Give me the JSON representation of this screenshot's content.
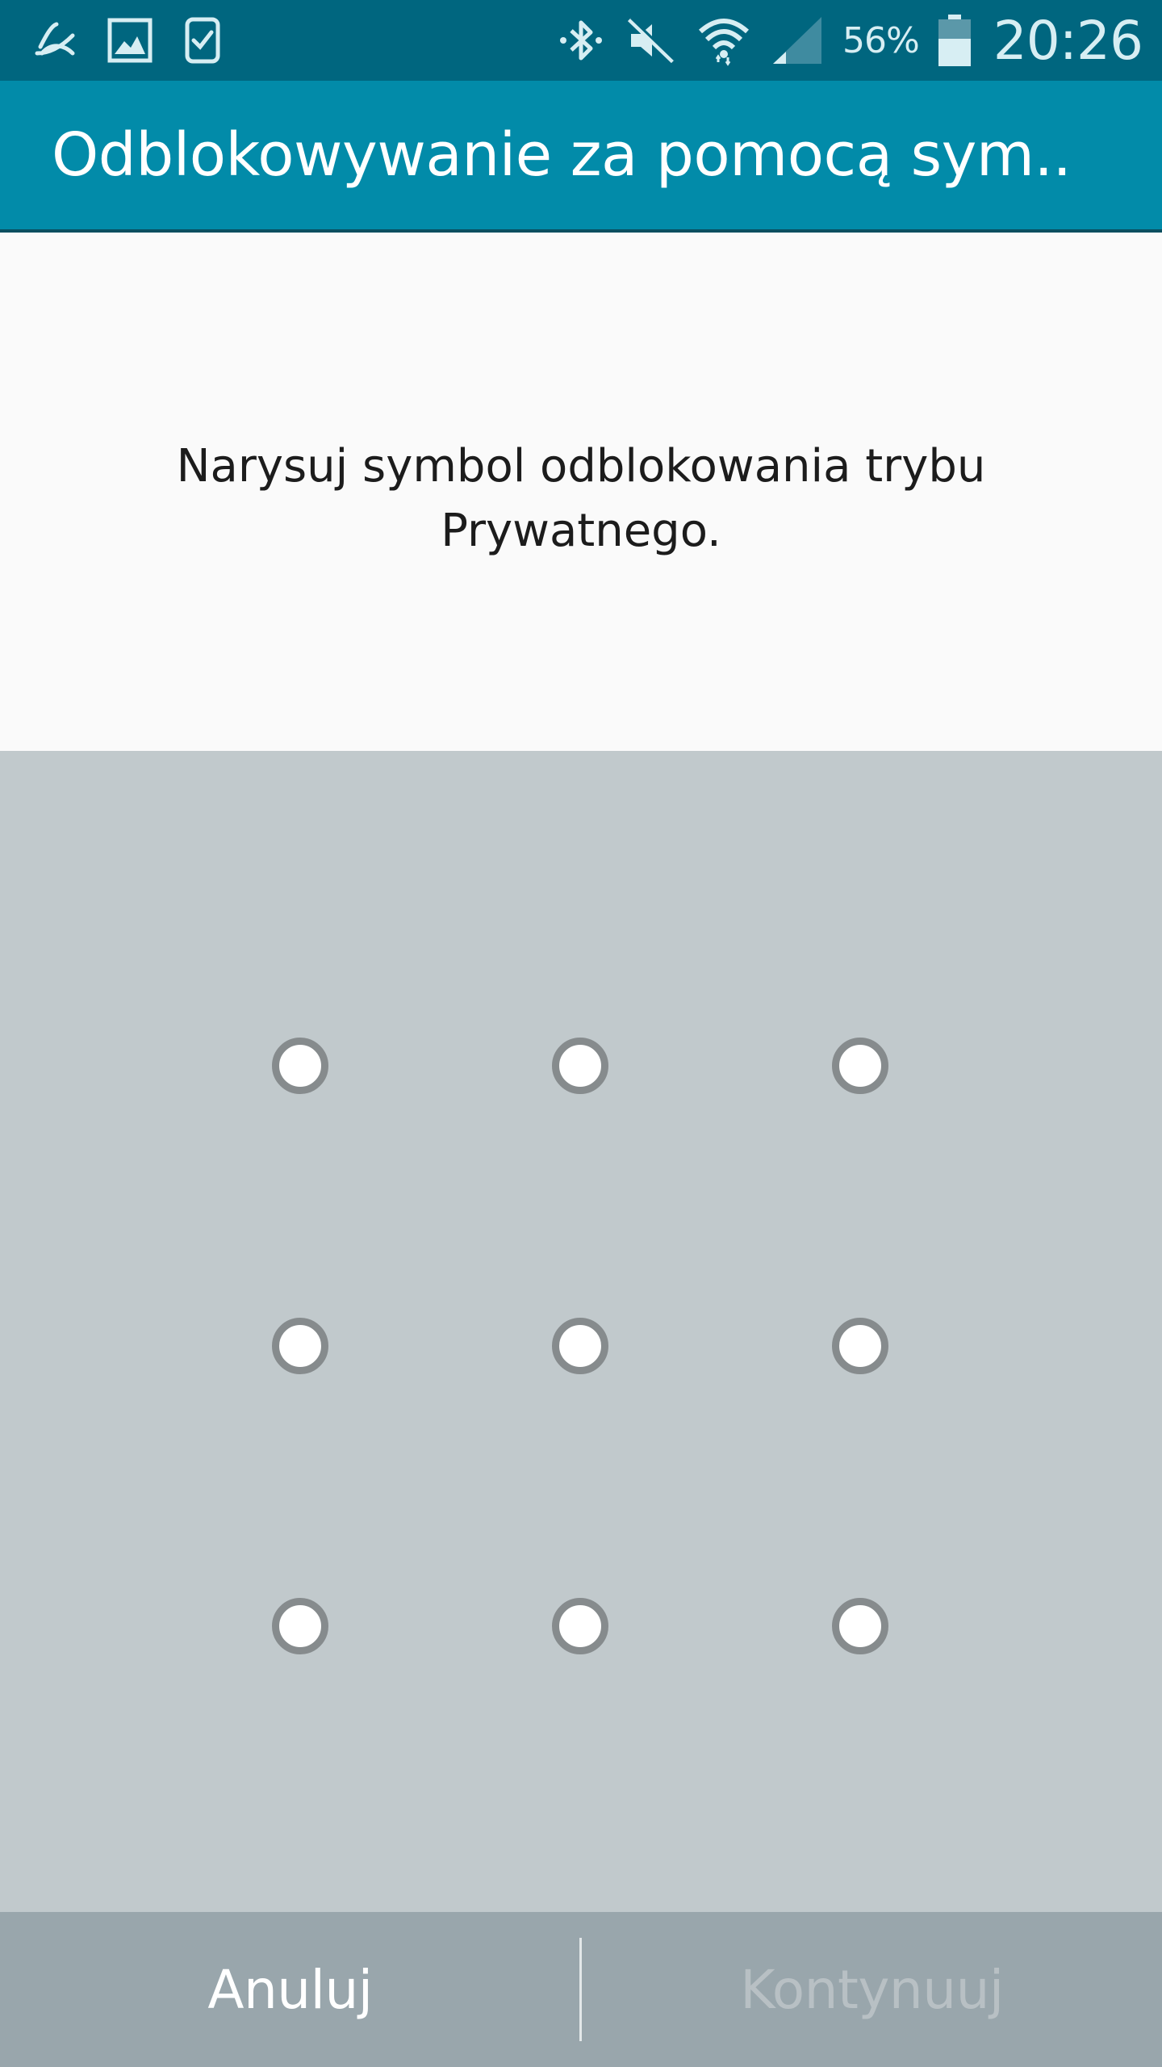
{
  "status_bar": {
    "left_icons": [
      "swiftkey-icon",
      "gallery-icon",
      "gear-fit-icon"
    ],
    "right_icons": [
      "bluetooth-icon",
      "mute-icon",
      "wifi-icon",
      "signal-icon"
    ],
    "battery_percent": "56%",
    "battery_icon": "battery-icon",
    "time": "20:26"
  },
  "app_bar": {
    "title": "Odblokowywanie za pomocą sym.."
  },
  "instruction": {
    "text": "Narysuj symbol odblokowania trybu Prywatnego."
  },
  "pattern": {
    "rows": 3,
    "cols": 3
  },
  "bottom_bar": {
    "cancel_label": "Anuluj",
    "continue_label": "Kontynuuj",
    "continue_enabled": false
  },
  "colors": {
    "status_bar": "#00667f",
    "app_bar": "#028ba9",
    "pattern_bg": "#c1c9cc",
    "bottom_bar": "#99a6ac"
  }
}
